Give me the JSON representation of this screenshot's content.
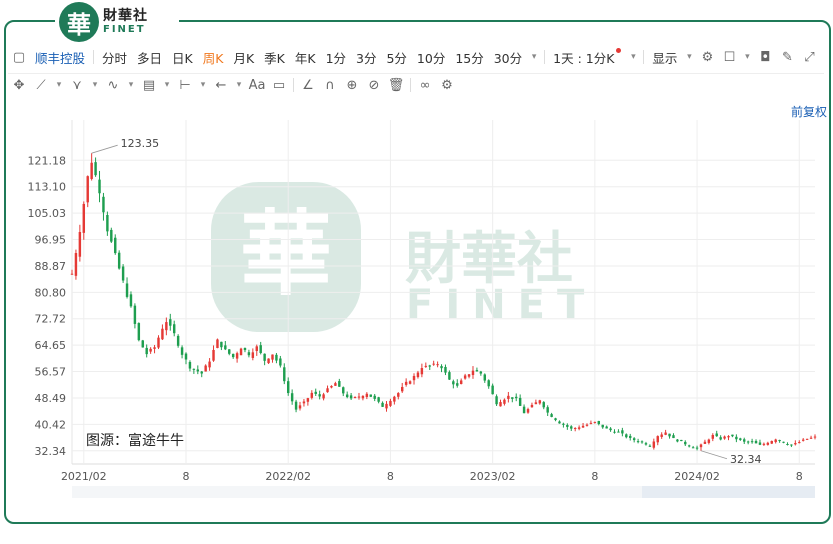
{
  "logo": {
    "mark": "華",
    "name_cn": "財華社",
    "name_en": "FINET"
  },
  "toolbar": {
    "stock_name": "顺丰控股",
    "periods": [
      "分时",
      "多日",
      "日K",
      "周K",
      "月K",
      "季K",
      "年K",
      "1分",
      "3分",
      "5分",
      "10分",
      "15分",
      "30分"
    ],
    "active_period": "周K",
    "multi_period": "1天 : 1分K",
    "display": "显示"
  },
  "toolbar2": {
    "text_tool": "Aa"
  },
  "adjust_label": "前复权",
  "watermark": {
    "mark": "華",
    "cn": "財華社",
    "en": "FINET"
  },
  "source_label": "图源：富途牛牛",
  "colors": {
    "up": "#e53935",
    "down": "#1e9e4f",
    "brand": "#1f7a58",
    "grid": "#eeeeee"
  },
  "chart_data": {
    "type": "candlestick",
    "y_ticks": [
      121.18,
      113.1,
      105.03,
      96.95,
      88.87,
      80.8,
      72.72,
      64.65,
      56.57,
      48.49,
      40.42,
      32.34
    ],
    "ylim": [
      28.3,
      133.5
    ],
    "x_tick_labels": [
      {
        "label": "2021/02",
        "t": 0
      },
      {
        "label": "8",
        "t": 26
      },
      {
        "label": "2022/02",
        "t": 52
      },
      {
        "label": "8",
        "t": 78
      },
      {
        "label": "2023/02",
        "t": 104
      },
      {
        "label": "8",
        "t": 130
      },
      {
        "label": "2024/02",
        "t": 156
      },
      {
        "label": "8",
        "t": 182
      }
    ],
    "max_annotation": {
      "label": "123.35",
      "value": 123.35,
      "t": 2
    },
    "min_annotation": {
      "label": "32.34",
      "value": 32.34,
      "t": 157
    },
    "close_path": [
      [
        -3,
        86.5
      ],
      [
        -1,
        100.0
      ],
      [
        0,
        108.0
      ],
      [
        1,
        116.0
      ],
      [
        2,
        121.0
      ],
      [
        4,
        112.0
      ],
      [
        6,
        100.0
      ],
      [
        8,
        92.0
      ],
      [
        10,
        84.0
      ],
      [
        12,
        76.0
      ],
      [
        14,
        66.0
      ],
      [
        16,
        62.0
      ],
      [
        18,
        64.0
      ],
      [
        20,
        70.0
      ],
      [
        21,
        72.0
      ],
      [
        23,
        68.0
      ],
      [
        25,
        62.0
      ],
      [
        27,
        58.0
      ],
      [
        30,
        56.0
      ],
      [
        32,
        60.0
      ],
      [
        34,
        66.0
      ],
      [
        36,
        63.0
      ],
      [
        38,
        61.0
      ],
      [
        40,
        64.0
      ],
      [
        42,
        62.0
      ],
      [
        44,
        64.0
      ],
      [
        46,
        60.0
      ],
      [
        48,
        62.0
      ],
      [
        50,
        58.0
      ],
      [
        52,
        50.0
      ],
      [
        54,
        45.0
      ],
      [
        56,
        47.0
      ],
      [
        58,
        50.0
      ],
      [
        60,
        49.0
      ],
      [
        62,
        51.0
      ],
      [
        64,
        53.0
      ],
      [
        66,
        50.0
      ],
      [
        68,
        48.0
      ],
      [
        70,
        49.0
      ],
      [
        72,
        50.0
      ],
      [
        74,
        48.0
      ],
      [
        76,
        46.0
      ],
      [
        78,
        48.0
      ],
      [
        80,
        50.0
      ],
      [
        82,
        53.0
      ],
      [
        84,
        55.0
      ],
      [
        86,
        58.0
      ],
      [
        88,
        58.0
      ],
      [
        90,
        59.0
      ],
      [
        91,
        58.0
      ],
      [
        93,
        54.0
      ],
      [
        95,
        52.0
      ],
      [
        97,
        55.0
      ],
      [
        99,
        57.0
      ],
      [
        101,
        56.0
      ],
      [
        103,
        52.0
      ],
      [
        105,
        47.0
      ],
      [
        108,
        49.0
      ],
      [
        110,
        48.0
      ],
      [
        112,
        44.0
      ],
      [
        114,
        46.0
      ],
      [
        116,
        48.0
      ],
      [
        118,
        44.0
      ],
      [
        121,
        41.0
      ],
      [
        124,
        39.0
      ],
      [
        127,
        40.0
      ],
      [
        130,
        41.0
      ],
      [
        133,
        39.0
      ],
      [
        136,
        38.0
      ],
      [
        139,
        36.0
      ],
      [
        142,
        35.0
      ],
      [
        144,
        34.0
      ],
      [
        146,
        37.0
      ],
      [
        148,
        38.0
      ],
      [
        150,
        36.0
      ],
      [
        152,
        35.0
      ],
      [
        154,
        34.0
      ],
      [
        156,
        33.0
      ],
      [
        158,
        35.0
      ],
      [
        160,
        37.0
      ],
      [
        162,
        36.0
      ],
      [
        164,
        37.0
      ],
      [
        166,
        36.0
      ],
      [
        168,
        35.0
      ],
      [
        170,
        35.0
      ],
      [
        172,
        34.0
      ],
      [
        174,
        35.0
      ],
      [
        176,
        36.0
      ],
      [
        178,
        35.0
      ],
      [
        180,
        34.0
      ],
      [
        182,
        35.0
      ],
      [
        184,
        36.0
      ],
      [
        186,
        36.5
      ]
    ],
    "t_range": [
      -3,
      186
    ]
  }
}
